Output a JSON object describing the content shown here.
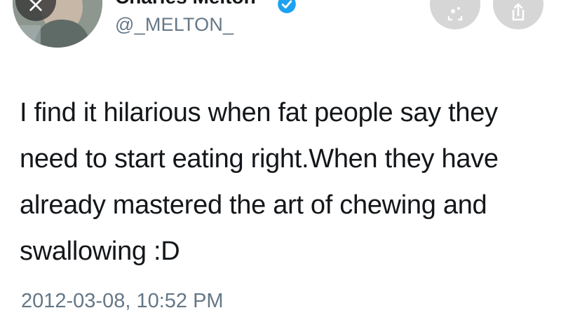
{
  "tweet": {
    "author_name": "Charles Melton",
    "handle": "@_MELTON_",
    "text": "I find it hilarious when fat people say they need to start eating right.When they have already mastered the art of chewing and swallowing :D",
    "timestamp": "2012-03-08, 10:52 PM"
  },
  "colors": {
    "text": "#14171a",
    "secondary_text": "#657786",
    "verified": "#1da1f2",
    "button_bg": "#d6d6d6"
  },
  "icons": {
    "close": "close-icon",
    "verified": "verified-badge-icon",
    "scan": "lens-icon",
    "share": "share-icon"
  }
}
